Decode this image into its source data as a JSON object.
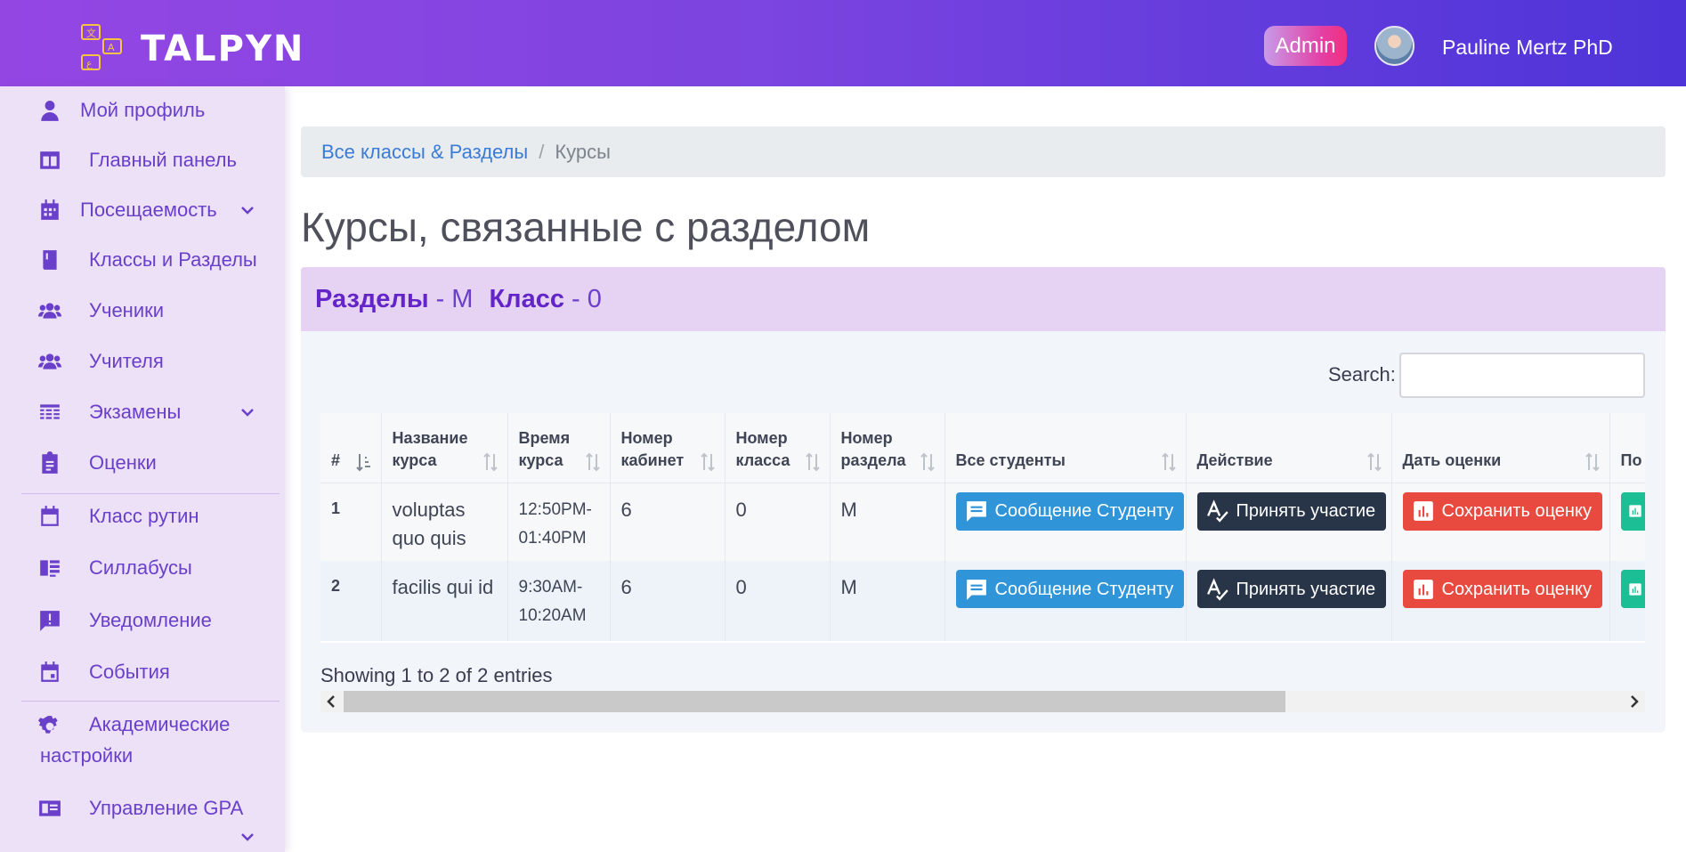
{
  "header": {
    "brand": "TALPYN",
    "role_badge": "Admin",
    "user_name": "Pauline Mertz PhD"
  },
  "sidebar": {
    "items": [
      {
        "label": "Мой профиль",
        "icon": "user-icon"
      },
      {
        "label": "Главный панель",
        "icon": "dashboard-icon"
      },
      {
        "label": "Посещаемость",
        "icon": "calendar-grid-icon",
        "expandable": true
      },
      {
        "label": "Классы и Разделы",
        "icon": "book-icon"
      },
      {
        "label": "Ученики",
        "icon": "users-icon"
      },
      {
        "label": "Учителя",
        "icon": "users-icon"
      },
      {
        "label": "Экзамены",
        "icon": "table-icon",
        "expandable": true
      },
      {
        "label": "Оценки",
        "icon": "clipboard-icon"
      },
      {
        "label": "Класс рутин",
        "icon": "calendar-icon"
      },
      {
        "label": "Силлабусы",
        "icon": "list-icon"
      },
      {
        "label": "Уведомление",
        "icon": "alert-message-icon"
      },
      {
        "label": "События",
        "icon": "event-icon"
      },
      {
        "label": "Академические настройки",
        "icon": "gear-icon"
      },
      {
        "label": "Управление GPA",
        "icon": "id-card-icon",
        "expandable": true
      }
    ]
  },
  "breadcrumb": {
    "link": "Все классы & Разделы",
    "separator": "/",
    "current": "Курсы"
  },
  "page_title": "Курсы, связанные с разделом",
  "section_header": {
    "section_label": "Разделы",
    "section_value": "- M",
    "class_label": "Класс",
    "class_value": "- 0"
  },
  "search": {
    "label": "Search:",
    "placeholder": ""
  },
  "table": {
    "columns": [
      "#",
      "Название курса",
      "Время курса",
      "Номер кабинет",
      "Номер класса",
      "Номер раздела",
      "Все студенты",
      "Действие",
      "Дать оценки",
      "По"
    ],
    "rows": [
      {
        "num": "1",
        "course": "voluptas quo quis",
        "time": "12:50PM-01:40PM",
        "room": "6",
        "class": "0",
        "section": "M",
        "btn_message": "Сообщение Студенту",
        "btn_attend": "Принять участие",
        "btn_grade": "Сохранить оценку"
      },
      {
        "num": "2",
        "course": "facilis qui id",
        "time": "9:30AM-10:20AM",
        "room": "6",
        "class": "0",
        "section": "M",
        "btn_message": "Сообщение Студенту",
        "btn_attend": "Принять участие",
        "btn_grade": "Сохранить оценку"
      }
    ],
    "footer": "Showing 1 to 2 of 2 entries"
  },
  "colors": {
    "header_start": "#9446e3",
    "header_end": "#4d34d8",
    "sidebar_bg": "#ece1f7",
    "accent": "#6a3fc9",
    "btn_message": "#2f95d8",
    "btn_attend": "#283448",
    "btn_grade": "#e84a3f",
    "btn_extra": "#1cbf95"
  }
}
